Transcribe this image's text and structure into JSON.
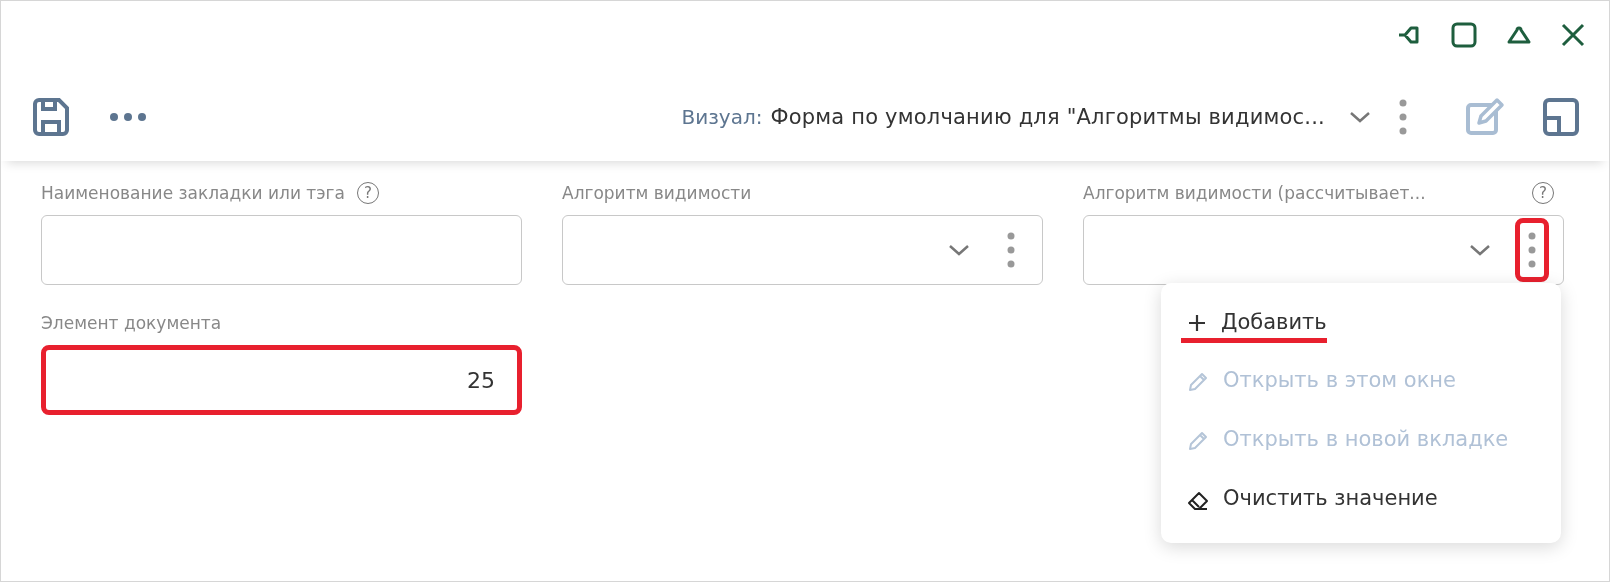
{
  "toolbar": {
    "visual_label": "Визуал:",
    "visual_value": "Форма по умолчанию для \"Алгоритмы видимос..."
  },
  "fields": [
    {
      "label": "Наименование закладки или тэга",
      "help": "?",
      "kind": "text",
      "highlighted": false
    },
    {
      "label": "Алгоритм видимости",
      "kind": "select",
      "menu_highlighted": false
    },
    {
      "label": "Алгоритм видимости (рассчитывает...",
      "help": "?",
      "kind": "select",
      "menu_highlighted": true
    },
    {
      "label": "Элемент документа",
      "kind": "number",
      "value": "25",
      "highlighted": true
    }
  ],
  "menu": [
    {
      "label": "Добавить",
      "kind": "add",
      "disabled": false,
      "highlighted": true
    },
    {
      "label": "Открыть в этом окне",
      "kind": "open",
      "disabled": true,
      "highlighted": false
    },
    {
      "label": "Открыть в новой вкладке",
      "kind": "open",
      "disabled": true,
      "highlighted": false
    },
    {
      "label": "Очистить значение",
      "kind": "clear",
      "disabled": false,
      "highlighted": false
    }
  ]
}
